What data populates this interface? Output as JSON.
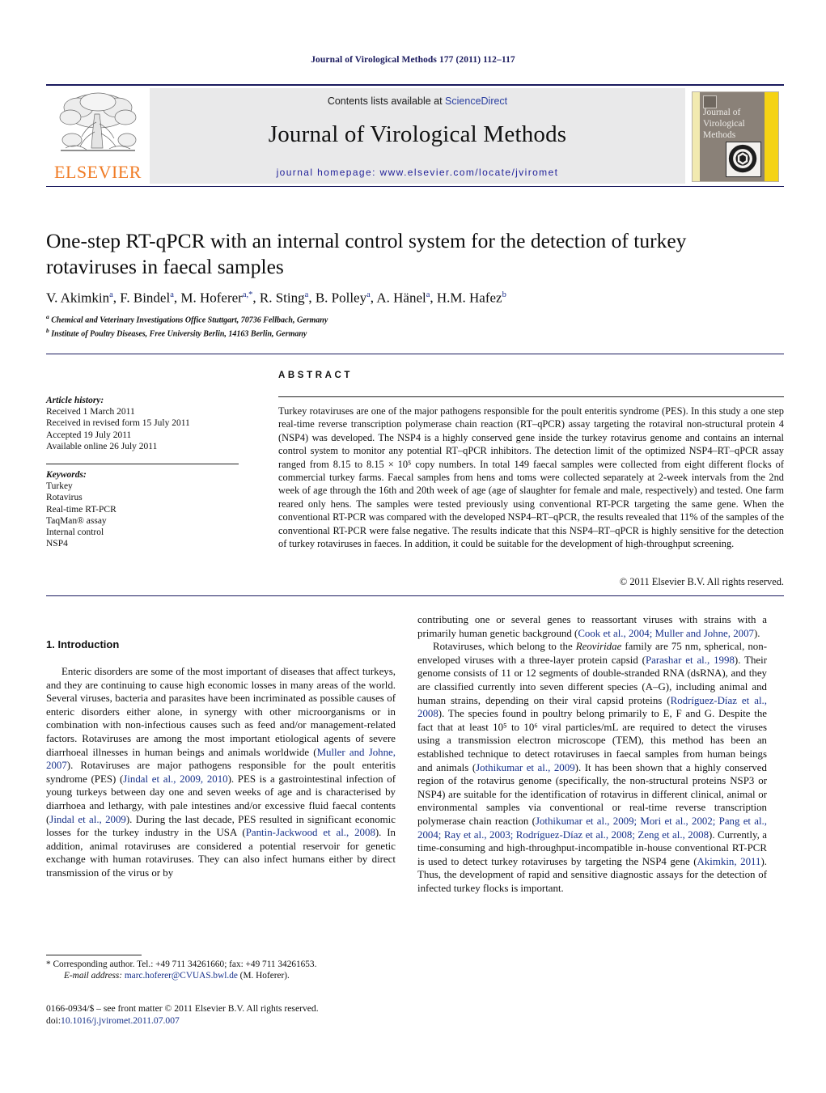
{
  "running_head": "Journal of Virological Methods 177 (2011) 112–117",
  "masthead": {
    "publisher_name": "ELSEVIER",
    "publisher_logo_alt": "elsevier-tree-logo",
    "contents_prefix": "Contents lists available at ",
    "contents_link": "ScienceDirect",
    "journal_title": "Journal of Virological Methods",
    "homepage_label": "journal homepage: www.elsevier.com/locate/jviromet",
    "cover_title": "Journal of Virological Methods",
    "cover_colors": {
      "band": "#8a8178",
      "left_stripe": "#f2eab0",
      "right_stripe": "#f5d314"
    }
  },
  "article": {
    "title": "One-step RT-qPCR with an internal control system for the detection of turkey rotaviruses in faecal samples",
    "authors_html": "V. Akimkin<sup>a</sup>, F. Bindel<sup>a</sup>, M. Hoferer<sup>a,*</sup>, R. Sting<sup>a</sup>, B. Polley<sup>a</sup>, A. Hänel<sup>a</sup>, H.M. Hafez<sup>b</sup>",
    "affiliation_a": "Chemical and Veterinary Investigations Office Stuttgart, 70736 Fellbach, Germany",
    "affiliation_b": "Institute of Poultry Diseases, Free University Berlin, 14163 Berlin, Germany"
  },
  "info": {
    "history_label": "Article history:",
    "history": [
      "Received 1 March 2011",
      "Received in revised form 15 July 2011",
      "Accepted 19 July 2011",
      "Available online 26 July 2011"
    ],
    "keywords_label": "Keywords:",
    "keywords": [
      "Turkey",
      "Rotavirus",
      "Real-time RT-PCR",
      "TaqMan® assay",
      "Internal control",
      "NSP4"
    ]
  },
  "abstract": {
    "heading": "ABSTRACT",
    "text": "Turkey rotaviruses are one of the major pathogens responsible for the poult enteritis syndrome (PES). In this study a one step real-time reverse transcription polymerase chain reaction (RT–qPCR) assay targeting the rotaviral non-structural protein 4 (NSP4) was developed. The NSP4 is a highly conserved gene inside the turkey rotavirus genome and contains an internal control system to monitor any potential RT–qPCR inhibitors. The detection limit of the optimized NSP4–RT–qPCR assay ranged from 8.15 to 8.15 × 10⁵ copy numbers. In total 149 faecal samples were collected from eight different flocks of commercial turkey farms. Faecal samples from hens and toms were collected separately at 2-week intervals from the 2nd week of age through the 16th and 20th week of age (age of slaughter for female and male, respectively) and tested. One farm reared only hens. The samples were tested previously using conventional RT-PCR targeting the same gene. When the conventional RT-PCR was compared with the developed NSP4–RT–qPCR, the results revealed that 11% of the samples of the conventional RT-PCR were false negative. The results indicate that this NSP4–RT–qPCR is highly sensitive for the detection of turkey rotaviruses in faeces. In addition, it could be suitable for the development of high-throughput screening.",
    "copyright": "© 2011 Elsevier B.V. All rights reserved."
  },
  "body": {
    "section_number_title": "1.  Introduction",
    "left_paragraph_1": "Enteric disorders are some of the most important of diseases that affect turkeys, and they are continuing to cause high economic losses in many areas of the world. Several viruses, bacteria and parasites have been incriminated as possible causes of enteric disorders either alone, in synergy with other microorganisms or in combination with non-infectious causes such as feed and/or management-related factors. Rotaviruses are among the most important etiological agents of severe diarrhoeal illnesses in human beings and animals worldwide (Muller and Johne, 2007). Rotaviruses are major pathogens responsible for the poult enteritis syndrome (PES) (Jindal et al., 2009, 2010). PES is a gastrointestinal infection of young turkeys between day one and seven weeks of age and is characterised by diarrhoea and lethargy, with pale intestines and/or excessive fluid faecal contents (Jindal et al., 2009). During the last decade, PES resulted in significant economic losses for the turkey industry in the USA (Pantin-Jackwood et al., 2008). In addition, animal rotaviruses are considered a potential reservoir for genetic exchange with human rotaviruses. They can also infect humans either by direct transmission of the virus or by",
    "right_paragraph_1": "contributing one or several genes to reassortant viruses with strains with a primarily human genetic background (Cook et al., 2004; Muller and Johne, 2007).",
    "right_paragraph_2": "Rotaviruses, which belong to the Reoviridae family are 75 nm, spherical, non-enveloped viruses with a three-layer protein capsid (Parashar et al., 1998). Their genome consists of 11 or 12 segments of double-stranded RNA (dsRNA), and they are classified currently into seven different species (A–G), including animal and human strains, depending on their viral capsid proteins (Rodríguez-Díaz et al., 2008). The species found in poultry belong primarily to E, F and G. Despite the fact that at least 10⁵ to 10⁶ viral particles/mL are required to detect the viruses using a transmission electron microscope (TEM), this method has been an established technique to detect rotaviruses in faecal samples from human beings and animals (Jothikumar et al., 2009). It has been shown that a highly conserved region of the rotavirus genome (specifically, the non-structural proteins NSP3 or NSP4) are suitable for the identification of rotavirus in different clinical, animal or environmental samples via conventional or real-time reverse transcription polymerase chain reaction (Jothikumar et al., 2009; Mori et al., 2002; Pang et al., 2004; Ray et al., 2003; Rodríguez-Díaz et al., 2008; Zeng et al., 2008). Currently, a time-consuming and high-throughput-incompatible in-house conventional RT-PCR is used to detect turkey rotaviruses by targeting the NSP4 gene (Akimkin, 2011). Thus, the development of rapid and sensitive diagnostic assays for the detection of infected turkey flocks is important."
  },
  "footnote": {
    "corresponding": "* Corresponding author. Tel.: +49 711 34261660; fax: +49 711 34261653.",
    "email_label": "E-mail address:",
    "email_link": "marc.hoferer@CVUAS.bwl.de",
    "email_suffix": " (M. Hoferer)."
  },
  "footer": {
    "issn_line": "0166-0934/$ – see front matter © 2011 Elsevier B.V. All rights reserved.",
    "doi_label": "doi:",
    "doi_value": "10.1016/j.jviromet.2011.07.007"
  }
}
